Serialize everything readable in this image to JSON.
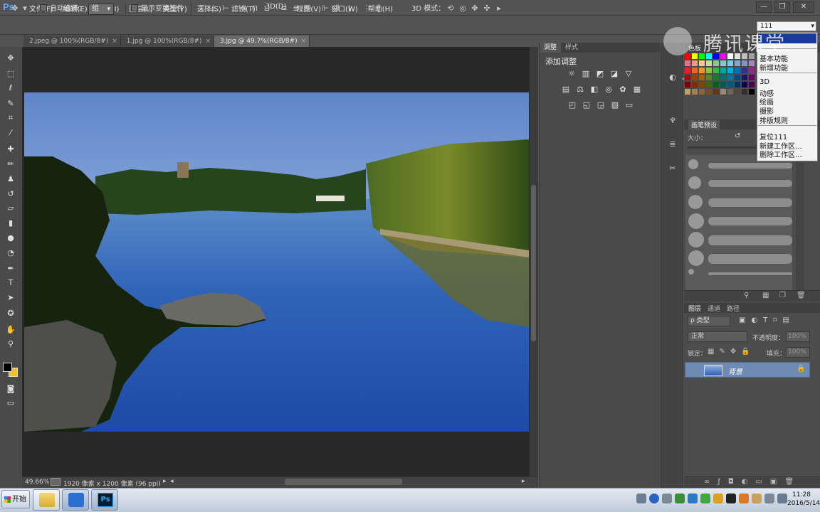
{
  "app": {
    "logo": "Ps",
    "menus": [
      "文件(F)",
      "编辑(E)",
      "图像(I)",
      "图层(L)",
      "类型(Y)",
      "选择(S)",
      "滤镜(T)",
      "3D(D)",
      "视图(V)",
      "窗口(W)",
      "帮助(H)"
    ],
    "window_controls": {
      "minimize": "—",
      "maximize": "❐",
      "close": "✕"
    }
  },
  "options": {
    "auto_select_label": "自动选择：",
    "auto_select_value": "组",
    "show_transform_label": "显示变换控件",
    "mode_3d_label": "3D 模式："
  },
  "tabs": [
    {
      "label": "2.jpeg @ 100%(RGB/8#)",
      "close": "×"
    },
    {
      "label": "1.jpg @ 100%(RGB/8#)",
      "close": "×"
    },
    {
      "label": "3.jpg @ 49.7%(RGB/8#)",
      "close": "×"
    }
  ],
  "status": {
    "zoom": "49.66%",
    "info": "1920 像素 x 1200 像素 (96 ppi)"
  },
  "adjustments": {
    "tabs": [
      "调整",
      "样式"
    ],
    "title": "添加调整"
  },
  "swatches_tab": "色板",
  "brush_preset": {
    "tab": "画笔预设",
    "size_label": "大小："
  },
  "layers": {
    "tabs": [
      "图层",
      "通道",
      "路径"
    ],
    "filter_label": "ρ 类型",
    "blend_mode": "正常",
    "opacity_label": "不透明度：",
    "opacity_value": "100%",
    "lock_label": "锁定：",
    "fill_label": "填充：",
    "fill_value": "100%",
    "layer_name": "背景"
  },
  "workspace": {
    "current": "111",
    "items_group1": [
      "基本功能",
      "新增功能"
    ],
    "items_group2": [
      "3D",
      "动感",
      "绘画",
      "摄影",
      "排版规则"
    ],
    "items_group3": [
      "复位111",
      "新建工作区...",
      "删除工作区..."
    ]
  },
  "watermark": "腾讯课堂",
  "taskbar": {
    "start_label": "开始",
    "time": "11:28",
    "date": "2016/5/14"
  },
  "colors": {
    "foreground": "#000000",
    "background": "#f2c21b",
    "layer_selected": "#6e8bb3",
    "menu_highlight": "#1a3a9a"
  }
}
